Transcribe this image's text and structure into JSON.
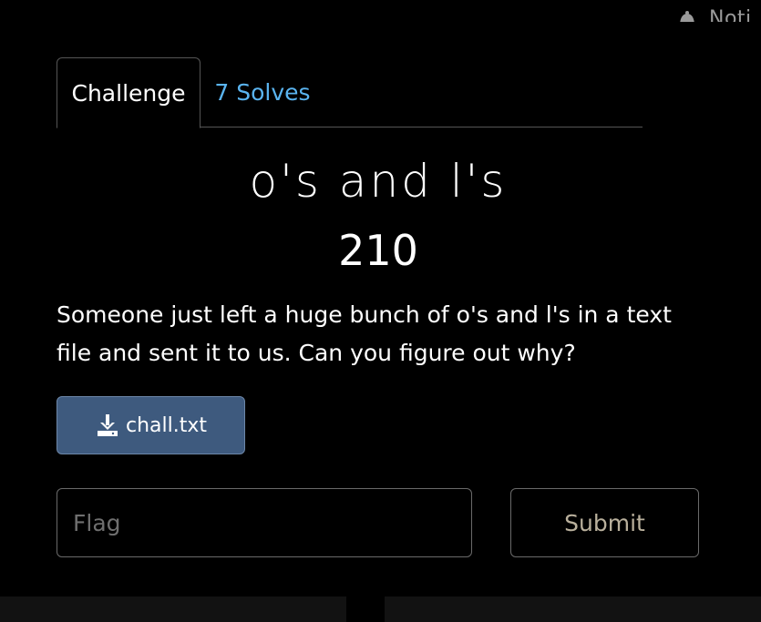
{
  "notification": {
    "label": "Noti",
    "icon": "bell-icon"
  },
  "tabs": [
    {
      "label": "Challenge",
      "active": true
    },
    {
      "label": "7 Solves",
      "active": false
    }
  ],
  "challenge": {
    "name": "o's and l's",
    "points": "210",
    "description": "Someone just left a huge bunch of o's and l's in a text file and sent it to us. Can you figure out why?",
    "file": {
      "label": "chall.txt",
      "icon": "download-icon"
    }
  },
  "flag_form": {
    "placeholder": "Flag",
    "value": "",
    "submit_label": "Submit"
  },
  "colors": {
    "background": "#000000",
    "link": "#5ab4f0",
    "download_button": "#3e5a7e",
    "submit_text": "#b9b09c"
  }
}
